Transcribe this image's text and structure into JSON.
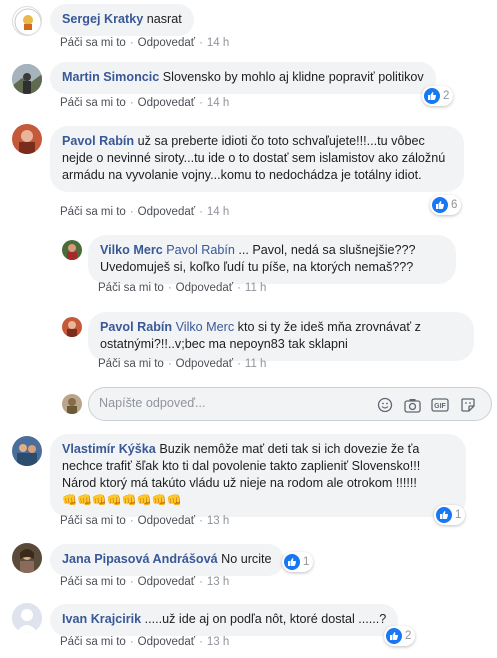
{
  "labels": {
    "like": "Páči sa mi to",
    "reply": "Odpovedať",
    "separator": "·"
  },
  "comments": [
    {
      "author": "Sergej Kratky",
      "text": "nasrat",
      "time": "14 h",
      "reactions": ""
    },
    {
      "author": "Martin Simoncic",
      "text": "Slovensko by mohlo aj klidne popraviť politikov",
      "time": "14 h",
      "reactions": "2"
    },
    {
      "author": "Pavol Rabín",
      "text": "už sa preberte idioti čo toto schvaľujete!!!...tu vôbec nejde o nevinné siroty...tu ide o to dostať sem islamistov ako záložnú armádu na vyvolanie vojny...komu to nedochádza je totálny idiot.",
      "time": "14 h",
      "reactions": "6"
    },
    {
      "author": "Vilko Merc",
      "reply_to": "Pavol Rabín",
      "text": "... Pavol, nedá sa slušnejšie??? Uvedomuješ si, koľko ľudí tu píše, na ktorých nemaš???",
      "time": "11 h",
      "reactions": ""
    },
    {
      "author": "Pavol Rabín",
      "reply_to": "Vilko Merc",
      "text": "kto si ty že ideš mňa zrovnávať z ostatnými?!!..v;bec ma nepoyn83 tak sklapni",
      "time": "11 h",
      "reactions": ""
    },
    {
      "author": "Vlastimír Kýška",
      "text": "Buzik nemôže mať deti tak si ich dovezie že ťa nechce trafiť šľak kto ti dal povolenie takto zaplieniť Slovensko!!! Národ ktorý má takúto vládu už nieje na rodom ale otrokom !!!!!!",
      "emojis": "👊👊👊👊👊👊👊👊",
      "time": "13 h",
      "reactions": "1"
    },
    {
      "author": "Jana Pipasová Andrášová",
      "text": "No urcite",
      "time": "13 h",
      "reactions": "1"
    },
    {
      "author": "Ivan Krajcirik",
      "text": ".....už ide aj on podľa nôt, ktoré dostal ......?",
      "time": "13 h",
      "reactions": "2"
    }
  ],
  "reply_box": {
    "placeholder": "Napíšte odpoveď..."
  },
  "colors": {
    "name": "#385898",
    "bubble": "#f2f3f5",
    "like_blue": "#1877f2"
  }
}
